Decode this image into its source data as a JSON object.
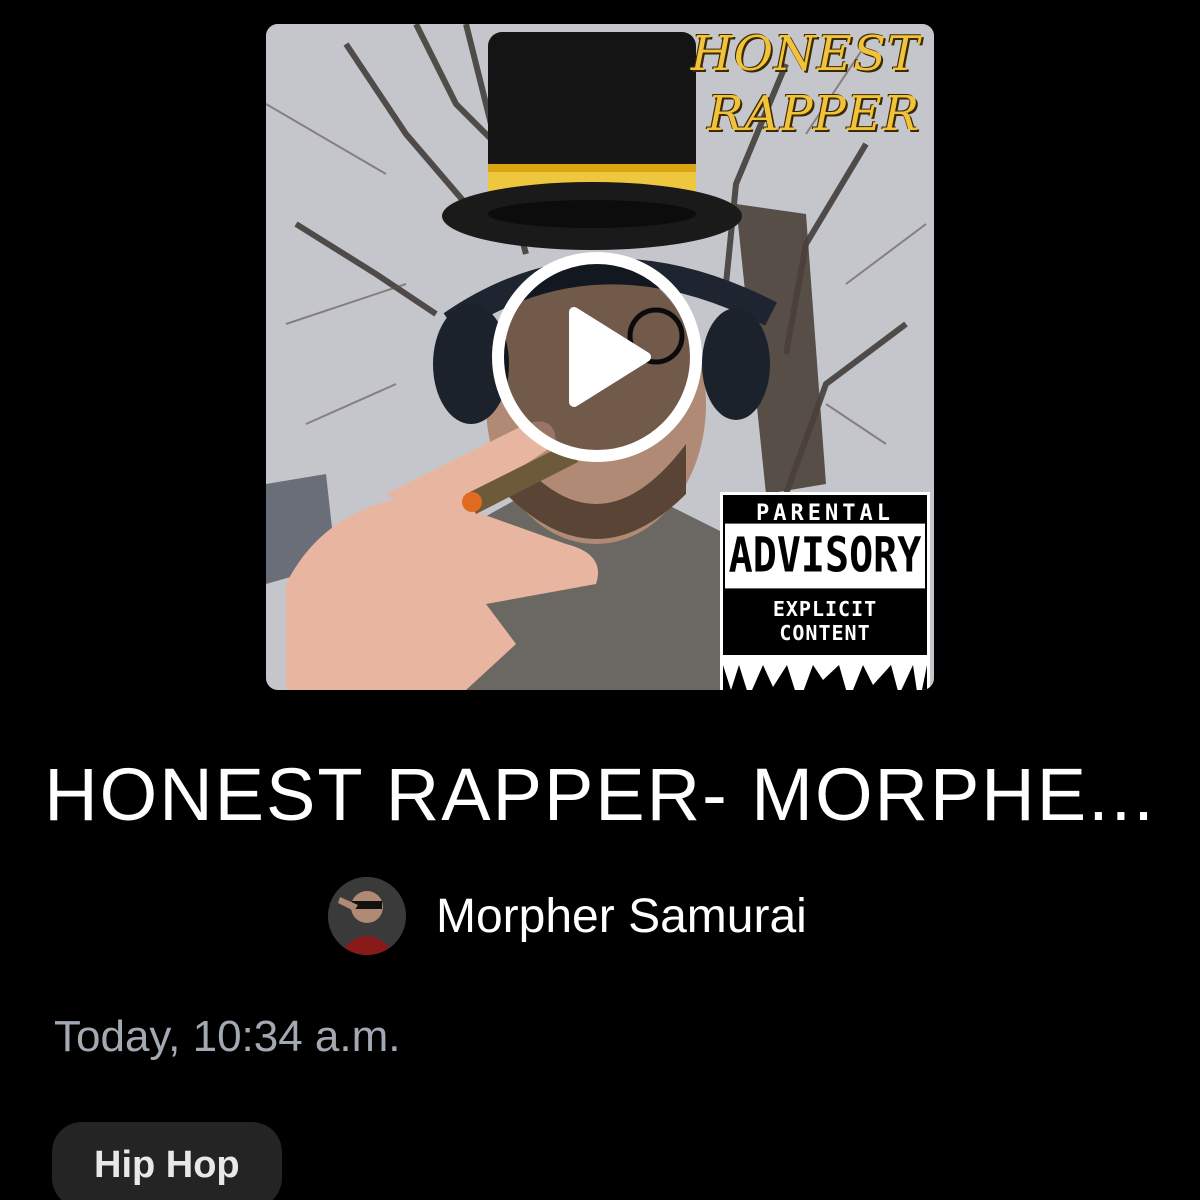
{
  "cover": {
    "title_line1": "HONEST",
    "title_line2": "RAPPER",
    "advisory_top": "PARENTAL",
    "advisory_mid": "ADVISORY",
    "advisory_bottom": "EXPLICIT CONTENT",
    "play_icon": "play-icon",
    "hat_icon": "top-hat-icon"
  },
  "track": {
    "title": "HONEST RAPPER- MORPHE..."
  },
  "artist": {
    "name": "Morpher Samurai",
    "avatar_icon": "avatar"
  },
  "meta": {
    "timestamp": "Today, 10:34 a.m."
  },
  "tags": {
    "genre": "Hip Hop"
  },
  "colors": {
    "background": "#000000",
    "title_gold": "#f2c23a",
    "muted_text": "#a3a9b3",
    "chip_bg": "#242424"
  }
}
